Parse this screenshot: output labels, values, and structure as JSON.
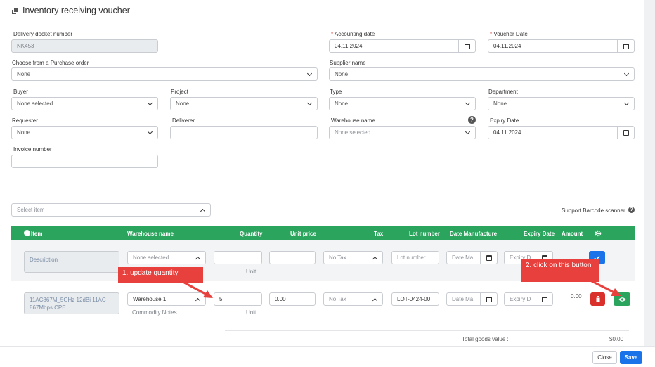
{
  "title": "Inventory receiving voucher",
  "form": {
    "delivery_docket_label": "Delivery docket number",
    "delivery_docket_value": "NK453",
    "accounting_date_label": "Accounting date",
    "accounting_date_value": "04.11.2024",
    "voucher_date_label": "Voucher Date",
    "voucher_date_value": "04.11.2024",
    "purchase_order_label": "Choose from a Purchase order",
    "purchase_order_value": "None",
    "supplier_label": "Supplier name",
    "supplier_value": "None",
    "buyer_label": "Buyer",
    "buyer_value": "None selected",
    "project_label": "Project",
    "project_value": "None",
    "type_label": "Type",
    "type_value": "None",
    "department_label": "Department",
    "department_value": "None",
    "requester_label": "Requester",
    "requester_value": "None",
    "deliverer_label": "Deliverer",
    "deliverer_value": "",
    "warehouse_label": "Warehouse name",
    "warehouse_value": "None selected",
    "expiry_label": "Expiry Date",
    "expiry_value": "04.11.2024",
    "invoice_label": "Invoice number",
    "invoice_value": ""
  },
  "select_item_placeholder": "Select item",
  "barcode_label": "Support Barcode scanner",
  "table": {
    "headers": [
      "Item",
      "Warehouse name",
      "Quantity",
      "Unit price",
      "Tax",
      "Lot number",
      "Date Manufacture",
      "Expiry Date",
      "Amount"
    ],
    "new_row": {
      "description_placeholder": "Description",
      "warehouse": "None selected",
      "unit": "Unit",
      "tax": "No Tax",
      "lot_placeholder": "Lot number",
      "date_placeholder": "Date Ma",
      "expiry_placeholder": "Expiry D"
    },
    "item_row": {
      "description": "11AC867M_5GHz 12dBi 11AC 867Mbps CPE",
      "warehouse": "Warehouse 1",
      "commodity_notes": "Commodity Notes",
      "quantity": "5",
      "unit": "Unit",
      "unit_price": "0.00",
      "tax": "No Tax",
      "lot_number": "LOT-0424-00",
      "date_placeholder": "Date Ma",
      "expiry_placeholder": "Expiry D",
      "amount": "0.00"
    }
  },
  "total_label": "Total goods value :",
  "total_value": "$0.00",
  "annotations": {
    "step1": "1. update quantity",
    "step2": "2. click on this button"
  },
  "footer": {
    "close": "Close",
    "save": "Save"
  },
  "colors": {
    "header_green": "#2ba55d",
    "primary_blue": "#1a73e8",
    "danger_red": "#d9302c",
    "view_green": "#2ba55d",
    "callout_red": "#e8403d"
  }
}
